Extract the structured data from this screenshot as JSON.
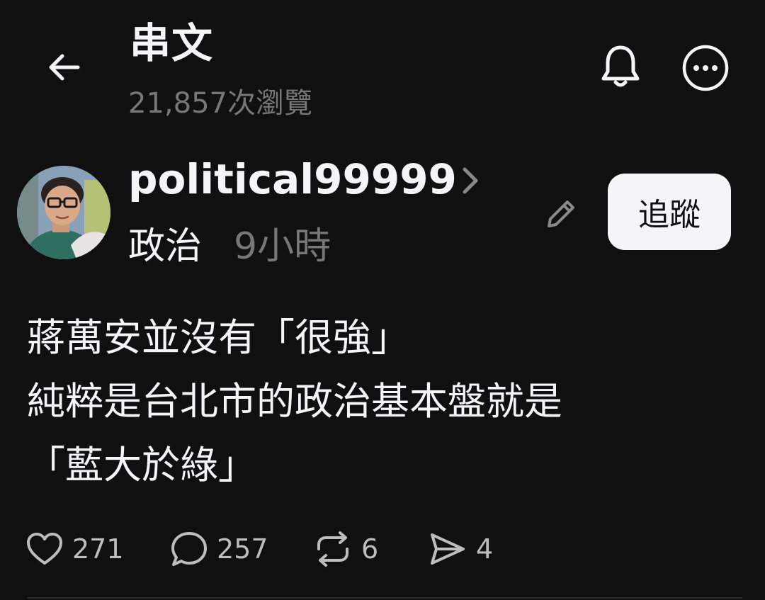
{
  "header": {
    "title": "串文",
    "views": "21,857次瀏覽"
  },
  "author": {
    "username": "political99999",
    "topic": "政治",
    "time": "9小時",
    "follow_label": "追蹤"
  },
  "post": {
    "lines": [
      "蔣萬安並沒有「很強」",
      "純粹是台北市的政治基本盤就是",
      "「藍大於綠」"
    ]
  },
  "actions": {
    "likes": "271",
    "replies": "257",
    "reposts": "6",
    "shares": "4"
  }
}
